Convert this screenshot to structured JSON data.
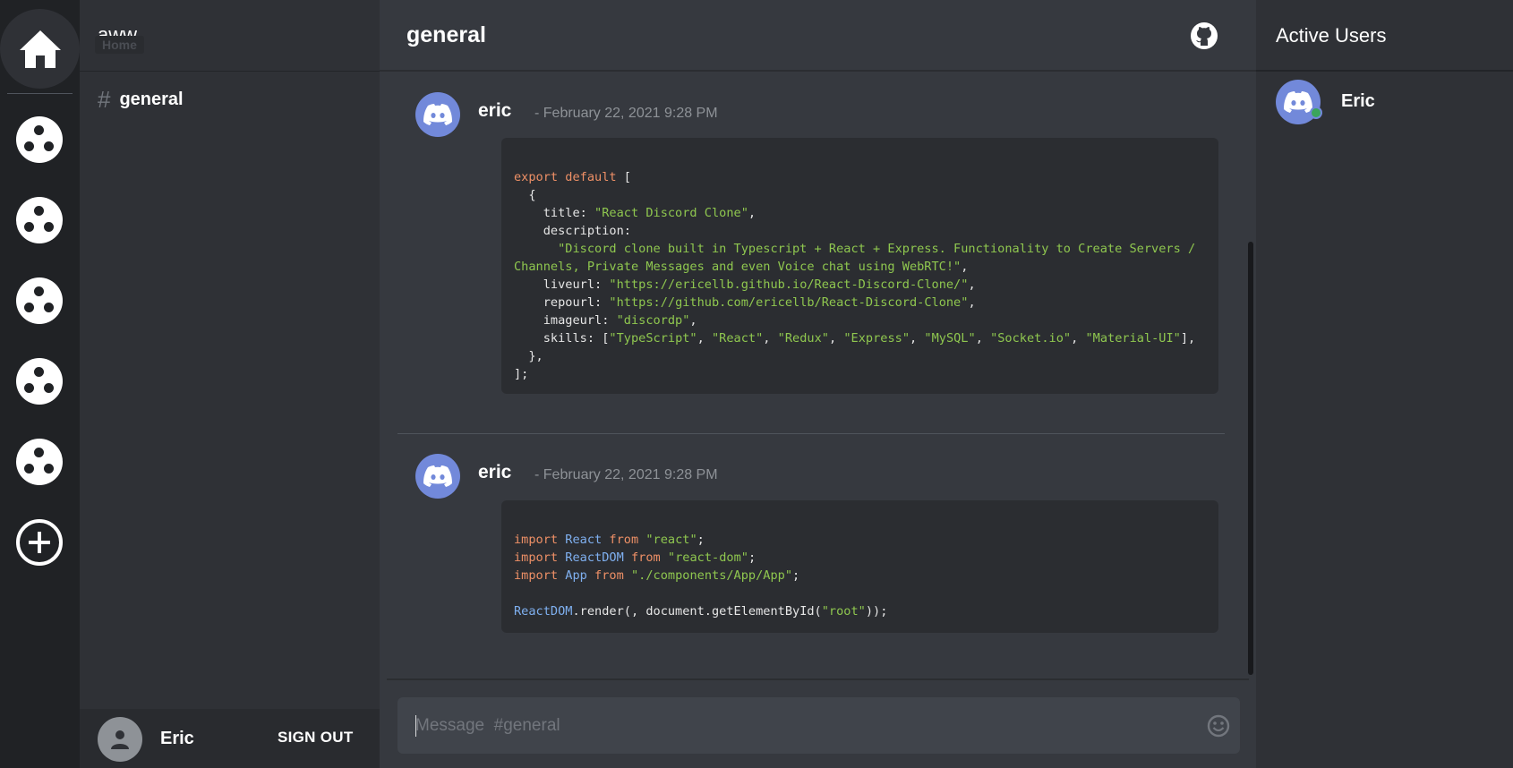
{
  "rail": {
    "home_tooltip": "Home",
    "servers": [
      "server-1",
      "server-2",
      "server-3",
      "server-4",
      "server-5"
    ]
  },
  "sidebar": {
    "server_name": "aww",
    "channel": "general",
    "user": {
      "name": "Eric",
      "signout_label": "SIGN OUT"
    }
  },
  "chat": {
    "channel_title": "general",
    "messages": [
      {
        "author": "eric",
        "timestamp": "- February 22, 2021 9:28 PM",
        "code_lines": [
          "export default [",
          "  {",
          "    title: \"React Discord Clone\",",
          "    description:",
          "      \"Discord clone built in Typescript + React + Express. Functionality to Create Servers /",
          "Channels, Private Messages and even Voice chat using WebRTC!\",",
          "    liveurl: \"https://ericellb.github.io/React-Discord-Clone/\",",
          "    repourl: \"https://github.com/ericellb/React-Discord-Clone\",",
          "    imageurl: \"discordp\",",
          "    skills: [\"TypeScript\", \"React\", \"Redux\", \"Express\", \"MySQL\", \"Socket.io\", \"Material-UI\"],",
          "  },",
          "];"
        ]
      },
      {
        "author": "eric",
        "timestamp": "- February 22, 2021 9:28 PM",
        "code_lines": [
          "import React from \"react\";",
          "import ReactDOM from \"react-dom\";",
          "import App from \"./components/App/App\";",
          "",
          "ReactDOM.render(, document.getElementById(\"root\"));"
        ]
      }
    ],
    "composer_placeholder": "Message  #general"
  },
  "active_users": {
    "title": "Active Users",
    "users": [
      {
        "name": "Eric",
        "status": "online"
      }
    ]
  },
  "colors": {
    "rail_bg": "#202225",
    "sidebar_bg": "#2f3136",
    "chat_bg": "#36393f",
    "blurple": "#7289da",
    "online": "#3ba55c",
    "code_keyword": "#ee9066",
    "code_string": "#8fc74f",
    "code_identifier": "#7fb0f0"
  }
}
